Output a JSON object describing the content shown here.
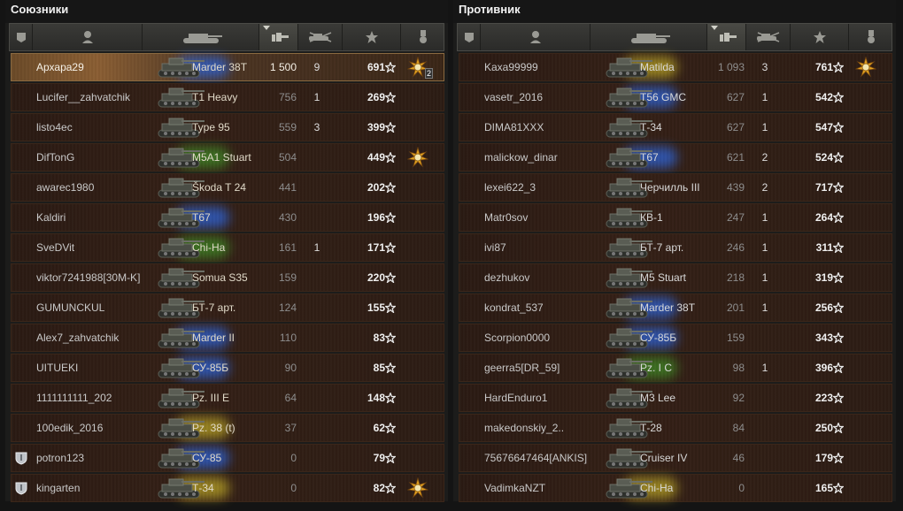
{
  "allies": {
    "title": "Союзники",
    "players": [
      {
        "name": "Архара29",
        "vehicle": "Marder 38T",
        "exp": "1 500",
        "frags": "9",
        "score": "691",
        "medal": true,
        "medal_count": "2",
        "self": true,
        "glow": "blue",
        "shield": false
      },
      {
        "name": "Lucifer__zahvatchik",
        "vehicle": "T1 Heavy",
        "exp": "756",
        "frags": "1",
        "score": "269",
        "medal": false,
        "self": false,
        "glow": "none",
        "shield": false
      },
      {
        "name": "listo4ec",
        "vehicle": "Type 95",
        "exp": "559",
        "frags": "3",
        "score": "399",
        "medal": false,
        "self": false,
        "glow": "none",
        "shield": false
      },
      {
        "name": "DifTonG",
        "vehicle": "M5A1 Stuart",
        "exp": "504",
        "frags": "",
        "score": "449",
        "medal": true,
        "self": false,
        "glow": "green",
        "shield": false
      },
      {
        "name": "awarec1980",
        "vehicle": "Škoda T 24",
        "exp": "441",
        "frags": "",
        "score": "202",
        "medal": false,
        "self": false,
        "glow": "none",
        "shield": false
      },
      {
        "name": "Kaldiri",
        "vehicle": "T67",
        "exp": "430",
        "frags": "",
        "score": "196",
        "medal": false,
        "self": false,
        "glow": "blue",
        "shield": false
      },
      {
        "name": "SveDVit",
        "vehicle": "Chi-Ha",
        "exp": "161",
        "frags": "1",
        "score": "171",
        "medal": false,
        "self": false,
        "glow": "green",
        "shield": false
      },
      {
        "name": "viktor7241988[30M-K]",
        "vehicle": "Somua S35",
        "exp": "159",
        "frags": "",
        "score": "220",
        "medal": false,
        "self": false,
        "glow": "none",
        "shield": false
      },
      {
        "name": "GUMUNCKUL",
        "vehicle": "БТ-7 арт.",
        "exp": "124",
        "frags": "",
        "score": "155",
        "medal": false,
        "self": false,
        "glow": "none",
        "shield": false
      },
      {
        "name": "Alex7_zahvatchik",
        "vehicle": "Marder II",
        "exp": "110",
        "frags": "",
        "score": "83",
        "medal": false,
        "self": false,
        "glow": "blue",
        "shield": false
      },
      {
        "name": "UITUEKI",
        "vehicle": "СУ-85Б",
        "exp": "90",
        "frags": "",
        "score": "85",
        "medal": false,
        "self": false,
        "glow": "blue",
        "shield": false
      },
      {
        "name": "1111111111_202",
        "vehicle": "Pz. III E",
        "exp": "64",
        "frags": "",
        "score": "148",
        "medal": false,
        "self": false,
        "glow": "none",
        "shield": false
      },
      {
        "name": "100edik_2016",
        "vehicle": "Pz. 38 (t)",
        "exp": "37",
        "frags": "",
        "score": "62",
        "medal": false,
        "self": false,
        "glow": "yellow",
        "shield": false
      },
      {
        "name": "potron123",
        "vehicle": "СУ-85",
        "exp": "0",
        "frags": "",
        "score": "79",
        "medal": false,
        "self": false,
        "glow": "blue",
        "shield": true
      },
      {
        "name": "kingarten",
        "vehicle": "Т-34",
        "exp": "0",
        "frags": "",
        "score": "82",
        "medal": true,
        "self": false,
        "glow": "yellow",
        "shield": true
      }
    ]
  },
  "enemies": {
    "title": "Противник",
    "players": [
      {
        "name": "Kaxa99999",
        "vehicle": "Matilda",
        "exp": "1 093",
        "frags": "3",
        "score": "761",
        "medal": true,
        "self": false,
        "glow": "yellow",
        "shield": false
      },
      {
        "name": "vasetr_2016",
        "vehicle": "T56 GMC",
        "exp": "627",
        "frags": "1",
        "score": "542",
        "medal": false,
        "self": false,
        "glow": "blue",
        "shield": false
      },
      {
        "name": "DIMA81XXX",
        "vehicle": "Т-34",
        "exp": "627",
        "frags": "1",
        "score": "547",
        "medal": false,
        "self": false,
        "glow": "none",
        "shield": false
      },
      {
        "name": "malickow_dinar",
        "vehicle": "T67",
        "exp": "621",
        "frags": "2",
        "score": "524",
        "medal": false,
        "self": false,
        "glow": "blue",
        "shield": false
      },
      {
        "name": "lexei622_3",
        "vehicle": "Черчилль III",
        "exp": "439",
        "frags": "2",
        "score": "717",
        "medal": false,
        "self": false,
        "glow": "none",
        "shield": false
      },
      {
        "name": "Matr0sov",
        "vehicle": "КВ-1",
        "exp": "247",
        "frags": "1",
        "score": "264",
        "medal": false,
        "self": false,
        "glow": "none",
        "shield": false
      },
      {
        "name": "ivi87",
        "vehicle": "БТ-7 арт.",
        "exp": "246",
        "frags": "1",
        "score": "311",
        "medal": false,
        "self": false,
        "glow": "none",
        "shield": false
      },
      {
        "name": "dezhukov",
        "vehicle": "M5 Stuart",
        "exp": "218",
        "frags": "1",
        "score": "319",
        "medal": false,
        "self": false,
        "glow": "none",
        "shield": false
      },
      {
        "name": "kondrat_537",
        "vehicle": "Marder 38T",
        "exp": "201",
        "frags": "1",
        "score": "256",
        "medal": false,
        "self": false,
        "glow": "blue",
        "shield": false
      },
      {
        "name": "Scorpion0000",
        "vehicle": "СУ-85Б",
        "exp": "159",
        "frags": "",
        "score": "343",
        "medal": false,
        "self": false,
        "glow": "blue",
        "shield": false
      },
      {
        "name": "geerra5[DR_59]",
        "vehicle": "Pz. I C",
        "exp": "98",
        "frags": "1",
        "score": "396",
        "medal": false,
        "self": false,
        "glow": "green",
        "shield": false
      },
      {
        "name": "HardEnduro1",
        "vehicle": "M3 Lee",
        "exp": "92",
        "frags": "",
        "score": "223",
        "medal": false,
        "self": false,
        "glow": "none",
        "shield": false
      },
      {
        "name": "makedonskiy_2..",
        "vehicle": "Т-28",
        "exp": "84",
        "frags": "",
        "score": "250",
        "medal": false,
        "self": false,
        "glow": "none",
        "shield": false
      },
      {
        "name": "75676647464[ANKIS]",
        "vehicle": "Cruiser IV",
        "exp": "46",
        "frags": "",
        "score": "179",
        "medal": false,
        "self": false,
        "glow": "none",
        "shield": false
      },
      {
        "name": "VadimkaNZT",
        "vehicle": "Chi-Ha",
        "exp": "0",
        "frags": "",
        "score": "165",
        "medal": false,
        "self": false,
        "glow": "yellow",
        "shield": false
      }
    ]
  },
  "colors": {
    "glow_blue": "#2d63d8",
    "glow_green": "#3f8a25",
    "glow_yellow": "#b8a326",
    "self_row": "#8a5e33",
    "row_bg": "#342016"
  },
  "icons": {
    "header": [
      "platoon-icon",
      "player-icon",
      "tank-icon",
      "experience-icon",
      "frags-icon",
      "star-icon",
      "medal-icon"
    ],
    "row": [
      "tank-silhouette-icon",
      "star-icon",
      "medal-icon",
      "clan-shield-icon"
    ]
  }
}
